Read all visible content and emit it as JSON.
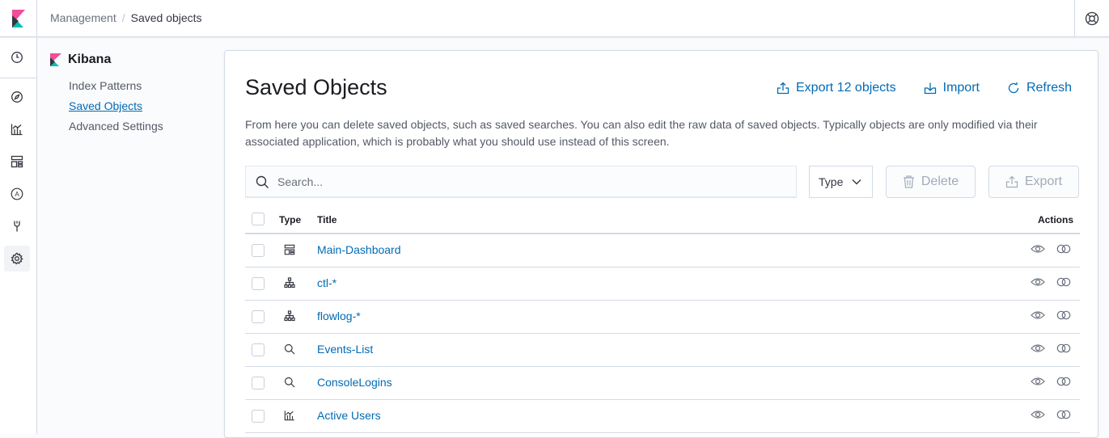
{
  "breadcrumbs": {
    "parent": "Management",
    "separator": "/",
    "current": "Saved objects"
  },
  "sidebar_nav": [
    "clock-icon",
    "compass-icon",
    "visualize-icon",
    "dashboard-icon",
    "canvas-icon",
    "devtools-icon",
    "gear-icon"
  ],
  "mgmt_nav": {
    "title": "Kibana",
    "links": [
      "Index Patterns",
      "Saved Objects",
      "Advanced Settings"
    ],
    "selected": "Saved Objects"
  },
  "panel": {
    "title": "Saved Objects",
    "export_all_label": "Export 12 objects",
    "import_label": "Import",
    "refresh_label": "Refresh",
    "description": "From here you can delete saved objects, such as saved searches. You can also edit the raw data of saved objects. Typically objects are only modified via their associated application, which is probably what you should use instead of this screen."
  },
  "toolbar": {
    "search_placeholder": "Search...",
    "type_filter_label": "Type",
    "delete_label": "Delete",
    "export_label": "Export"
  },
  "table": {
    "headers": {
      "type": "Type",
      "title": "Title",
      "actions": "Actions"
    },
    "rows": [
      {
        "type": "dashboard",
        "title": "Main-Dashboard"
      },
      {
        "type": "index-pattern",
        "title": "ctl-*"
      },
      {
        "type": "index-pattern",
        "title": "flowlog-*"
      },
      {
        "type": "search",
        "title": "Events-List"
      },
      {
        "type": "search",
        "title": "ConsoleLogins"
      },
      {
        "type": "visualization",
        "title": "Active Users"
      }
    ]
  },
  "colors": {
    "link": "#006bb4",
    "border": "#d3dae6",
    "text": "#343741",
    "disabled": "#a2abba"
  }
}
